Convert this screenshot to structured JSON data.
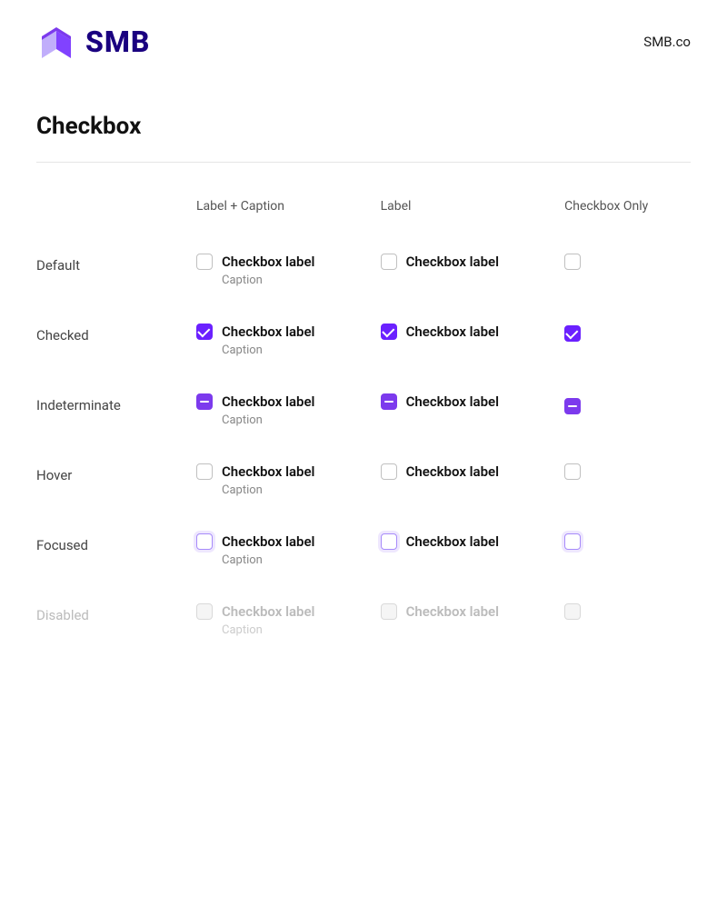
{
  "header": {
    "logo_text": "SMB",
    "nav_link": "SMB.co"
  },
  "page": {
    "title": "Checkbox"
  },
  "table": {
    "columns": {
      "col0": "",
      "col1": "Label + Caption",
      "col2": "Label",
      "col3": "Checkbox Only"
    },
    "rows": [
      {
        "id": "default",
        "label": "Default",
        "state": "default"
      },
      {
        "id": "checked",
        "label": "Checked",
        "state": "checked"
      },
      {
        "id": "indeterminate",
        "label": "Indeterminate",
        "state": "indeterminate"
      },
      {
        "id": "hover",
        "label": "Hover",
        "state": "hover"
      },
      {
        "id": "focused",
        "label": "Focused",
        "state": "focused"
      },
      {
        "id": "disabled",
        "label": "Disabled",
        "state": "disabled"
      }
    ],
    "checkbox_label": "Checkbox label",
    "caption": "Caption"
  }
}
